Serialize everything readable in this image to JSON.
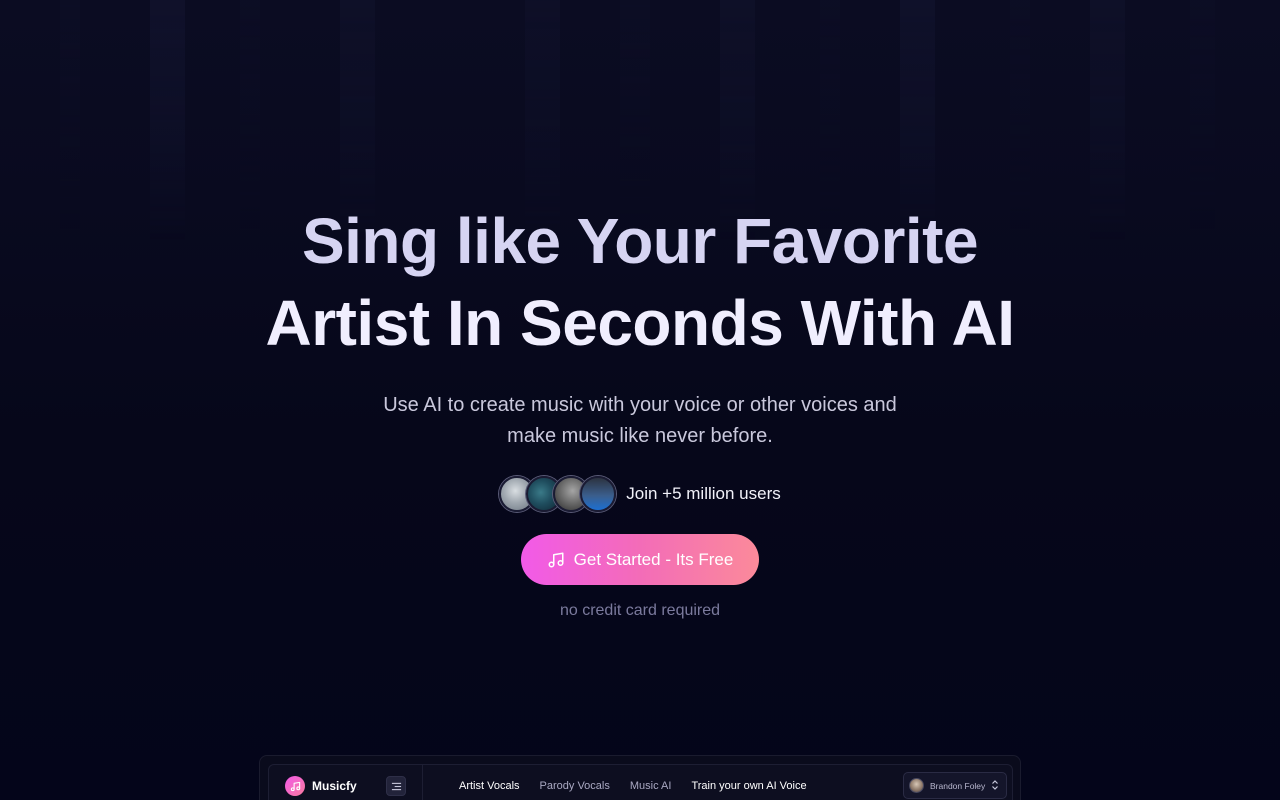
{
  "hero": {
    "title_line1": "Sing like Your Favorite",
    "title_line2": "Artist In Seconds With AI",
    "subtitle": "Use AI to create music with your voice or other voices and make music like never before.",
    "users_label": "Join +5 million users",
    "cta_label": "Get Started - Its Free",
    "cta_icon": "music-note-icon",
    "no_card_text": "no credit card required"
  },
  "colors": {
    "background": "#05061a",
    "cta_gradient_start": "#f25ae8",
    "cta_gradient_end": "#fb8a9a",
    "muted_text": "#7b7a9d"
  },
  "app_preview": {
    "brand": "Musicfy",
    "nav": [
      {
        "label": "Artist Vocals"
      },
      {
        "label": "Parody Vocals"
      },
      {
        "label": "Music AI"
      },
      {
        "label": "Train your own AI Voice"
      }
    ],
    "user_name": "Brandon Foley"
  }
}
